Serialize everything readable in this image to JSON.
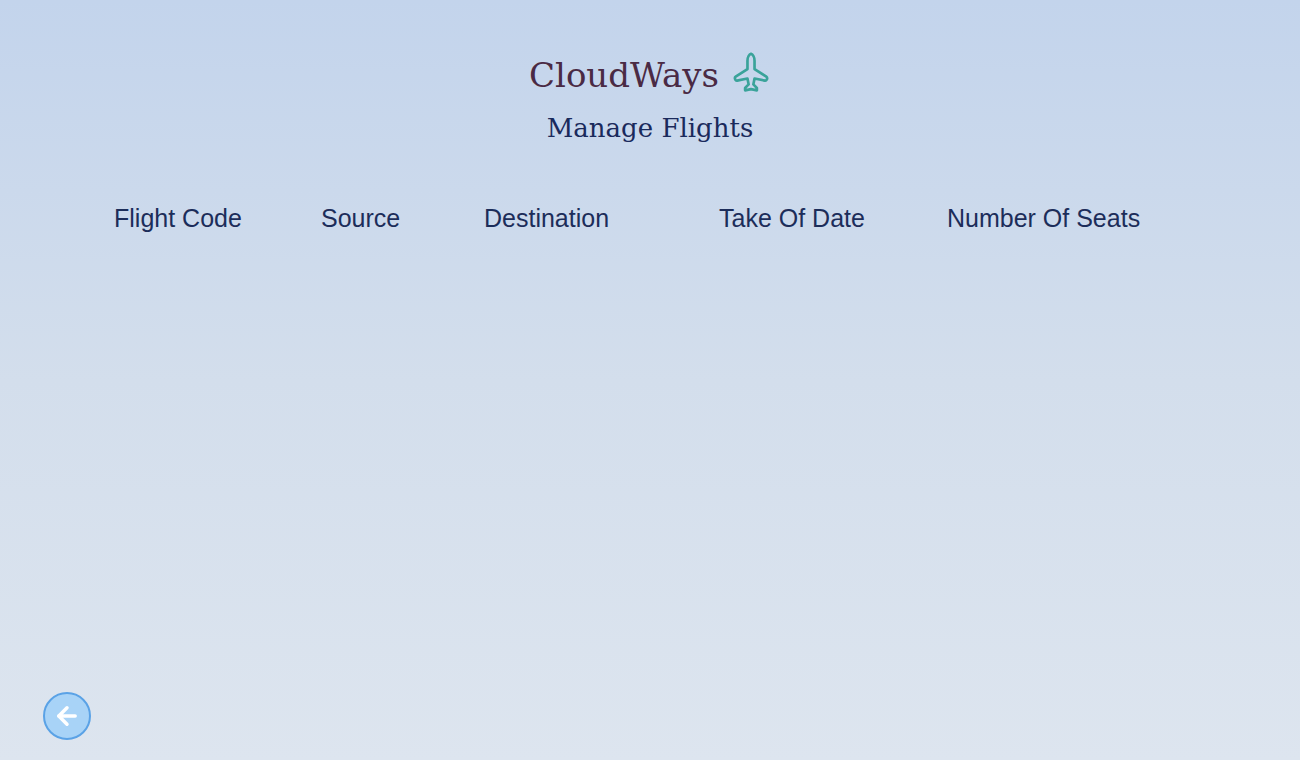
{
  "header": {
    "title": "CloudWays",
    "subtitle": "Manage Flights"
  },
  "table": {
    "columns": [
      "Flight Code",
      "Source",
      "Destination",
      "Take Of Date",
      "Number Of Seats"
    ]
  }
}
